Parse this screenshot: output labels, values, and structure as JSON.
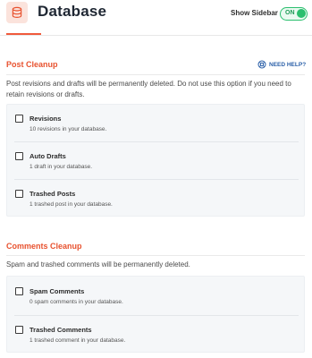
{
  "header": {
    "title": "Database",
    "show_sidebar_label": "Show Sidebar",
    "toggle_label": "ON",
    "logo_icon": "database-stack-icon"
  },
  "colors": {
    "accent": "#e8522f",
    "toggle_green": "#2cbf6f",
    "help_blue": "#2a5fa8"
  },
  "sections": {
    "post_cleanup": {
      "title": "Post Cleanup",
      "help_label": "NEED HELP?",
      "description": "Post revisions and drafts will be permanently deleted. Do not use this option if you need to retain revisions or drafts.",
      "items": [
        {
          "label": "Revisions",
          "detail": "10 revisions in your database."
        },
        {
          "label": "Auto Drafts",
          "detail": "1 draft in your database."
        },
        {
          "label": "Trashed Posts",
          "detail": "1 trashed post in your database."
        }
      ]
    },
    "comments_cleanup": {
      "title": "Comments Cleanup",
      "description": "Spam and trashed comments will be permanently deleted.",
      "items": [
        {
          "label": "Spam Comments",
          "detail": "0 spam comments in your database."
        },
        {
          "label": "Trashed Comments",
          "detail": "1 trashed comment in your database."
        }
      ]
    }
  }
}
